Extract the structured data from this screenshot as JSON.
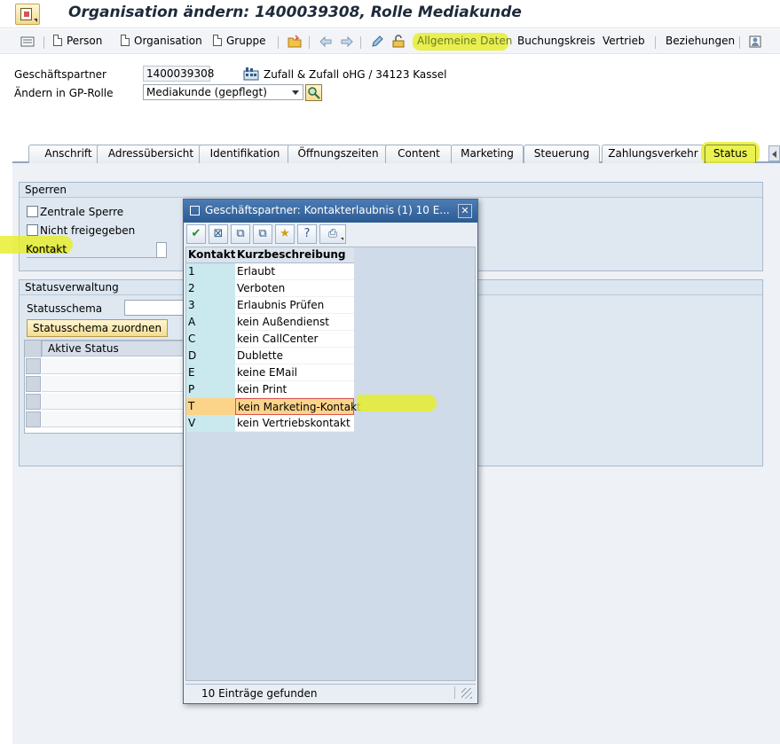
{
  "window": {
    "title": "Organisation ändern: 1400039308, Rolle Mediakunde"
  },
  "toolbar": {
    "person": "Person",
    "organisation": "Organisation",
    "gruppe": "Gruppe",
    "allgemeine_daten": "Allgemeine Daten",
    "buchungskreis": "Buchungskreis",
    "vertrieb": "Vertrieb",
    "beziehungen": "Beziehungen"
  },
  "header": {
    "gp_label": "Geschäftspartner",
    "gp_value": "1400039308",
    "gp_name": "Zufall & Zufall oHG / 34123 Kassel",
    "rolle_label": "Ändern in GP-Rolle",
    "rolle_value": "Mediakunde (gepflegt)"
  },
  "tabs": [
    {
      "label": "Anschrift"
    },
    {
      "label": "Adressübersicht"
    },
    {
      "label": "Identifikation"
    },
    {
      "label": "Öffnungszeiten"
    },
    {
      "label": "Content"
    },
    {
      "label": "Marketing"
    },
    {
      "label": "Steuerung"
    },
    {
      "label": "Zahlungsverkehr"
    },
    {
      "label": "Status"
    }
  ],
  "sperren": {
    "title": "Sperren",
    "zentrale": "Zentrale Sperre",
    "nicht_freigegeben": "Nicht freigegeben",
    "kontakt": "Kontakt"
  },
  "statusverwaltung": {
    "title": "Statusverwaltung",
    "schema_label": "Statusschema",
    "assign_button": "Statusschema zuordnen",
    "col_aktive_status": "Aktive Status"
  },
  "popup": {
    "title": "Geschäftspartner: Kontakterlaubnis (1)   10 E...",
    "col_kontakt": "Kontakt",
    "col_beschreibung": "Kurzbeschreibung",
    "rows": [
      {
        "k": "1",
        "d": "Erlaubt"
      },
      {
        "k": "2",
        "d": "Verboten"
      },
      {
        "k": "3",
        "d": "Erlaubnis Prüfen"
      },
      {
        "k": "A",
        "d": "kein Außendienst"
      },
      {
        "k": "C",
        "d": "kein CallCenter"
      },
      {
        "k": "D",
        "d": "Dublette"
      },
      {
        "k": "E",
        "d": "keine EMail"
      },
      {
        "k": "P",
        "d": "kein Print"
      },
      {
        "k": "T",
        "d": "kein Marketing-Kontakt"
      },
      {
        "k": "V",
        "d": "kein Vertriebskontakt"
      }
    ],
    "status": "10 Einträge gefunden"
  },
  "colors": {
    "highlight": "#e6ee28",
    "selection": "#fbd48a",
    "titlebar": "#2c5a93"
  }
}
